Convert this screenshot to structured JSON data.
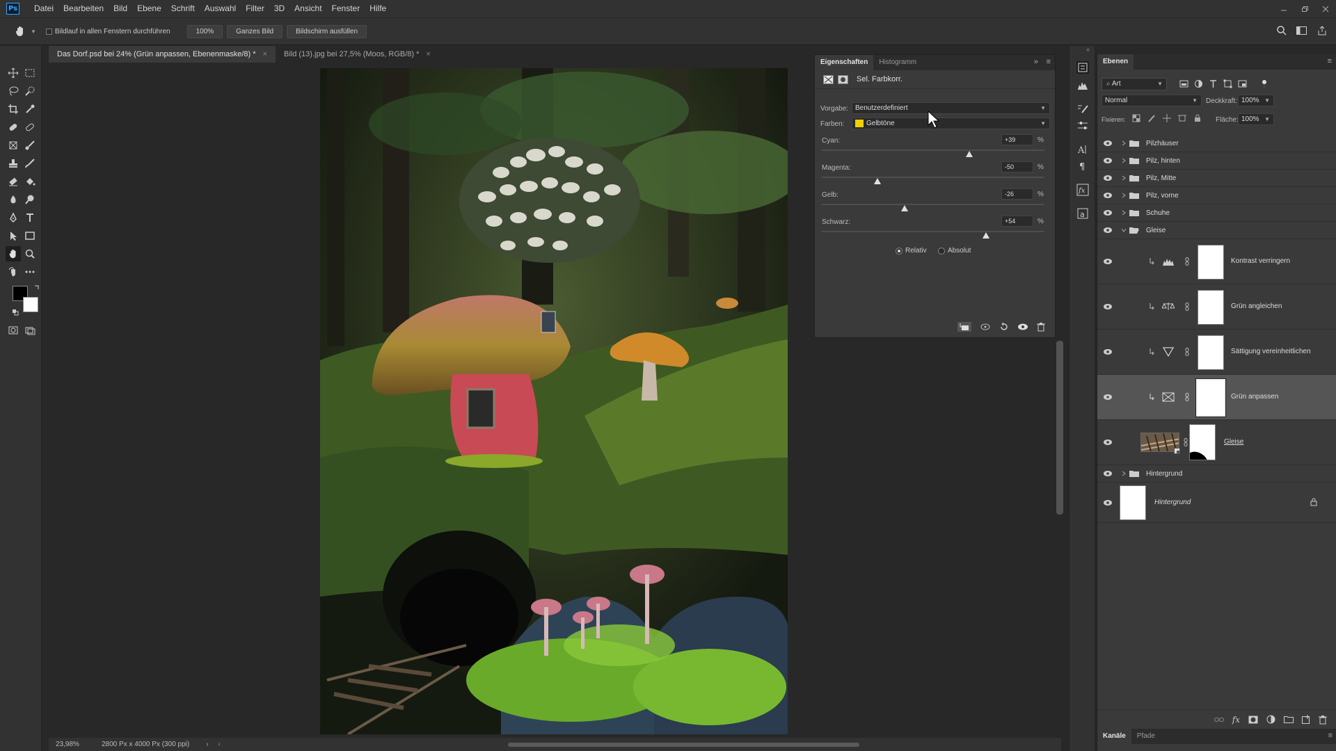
{
  "app": {
    "logo": "Ps"
  },
  "menu": [
    "Datei",
    "Bearbeiten",
    "Bild",
    "Ebene",
    "Schrift",
    "Auswahl",
    "Filter",
    "3D",
    "Ansicht",
    "Fenster",
    "Hilfe"
  ],
  "options": {
    "scroll_all_label": "Bildlauf in allen Fenstern durchführen",
    "zoom_btn": "100%",
    "fit_btn": "Ganzes Bild",
    "fill_btn": "Bildschirm ausfüllen"
  },
  "doc_tabs": [
    {
      "label": "Das Dorf.psd bei 24% (Grün anpassen, Ebenenmaske/8) *",
      "active": true
    },
    {
      "label": "Bild (13).jpg bei 27,5% (Moos, RGB/8) *",
      "active": false
    }
  ],
  "status": {
    "zoom": "23,98%",
    "doc_info": "2800 Px x 4000 Px (300 ppi)"
  },
  "properties": {
    "tabs": [
      "Eigenschaften",
      "Histogramm"
    ],
    "title": "Sel. Farbkorr.",
    "preset_label": "Vorgabe:",
    "preset_value": "Benutzerdefiniert",
    "colors_label": "Farben:",
    "colors_value": "Gelbtöne",
    "colors_swatch": "#f0d000",
    "sliders": [
      {
        "label": "Cyan:",
        "value": "+39",
        "pct": 39
      },
      {
        "label": "Magenta:",
        "value": "-50",
        "pct": -50
      },
      {
        "label": "Gelb:",
        "value": "-26",
        "pct": -26
      },
      {
        "label": "Schwarz:",
        "value": "+54",
        "pct": 54
      }
    ],
    "percent_sign": "%",
    "method_relative": "Relativ",
    "method_absolute": "Absolut"
  },
  "layers": {
    "tab": "Ebenen",
    "filter_label": "Art",
    "blend_mode": "Normal",
    "opacity_label": "Deckkraft:",
    "opacity_value": "100%",
    "lock_label": "Fixieren:",
    "fill_label": "Fläche:",
    "fill_value": "100%",
    "groups_top": [
      "Pilzhäuser",
      "Pilz, hinten",
      "Pilz, Mitte",
      "Pilz, vorne",
      "Schuhe",
      "Gleise"
    ],
    "adjustments": [
      {
        "name": "Kontrast verringern",
        "icon": "levels-icon"
      },
      {
        "name": "Grün angleichen",
        "icon": "color-balance-icon"
      },
      {
        "name": "Sättigung vereinheitlichen",
        "icon": "vibrance-icon"
      },
      {
        "name": "Grün anpassen",
        "icon": "selective-color-icon",
        "selected": true
      }
    ],
    "image_layer": "Gleise",
    "group_bottom": "Hintergrund",
    "background_layer": "Hintergrund"
  },
  "bottom_tabs": [
    "Kanäle",
    "Pfade"
  ]
}
